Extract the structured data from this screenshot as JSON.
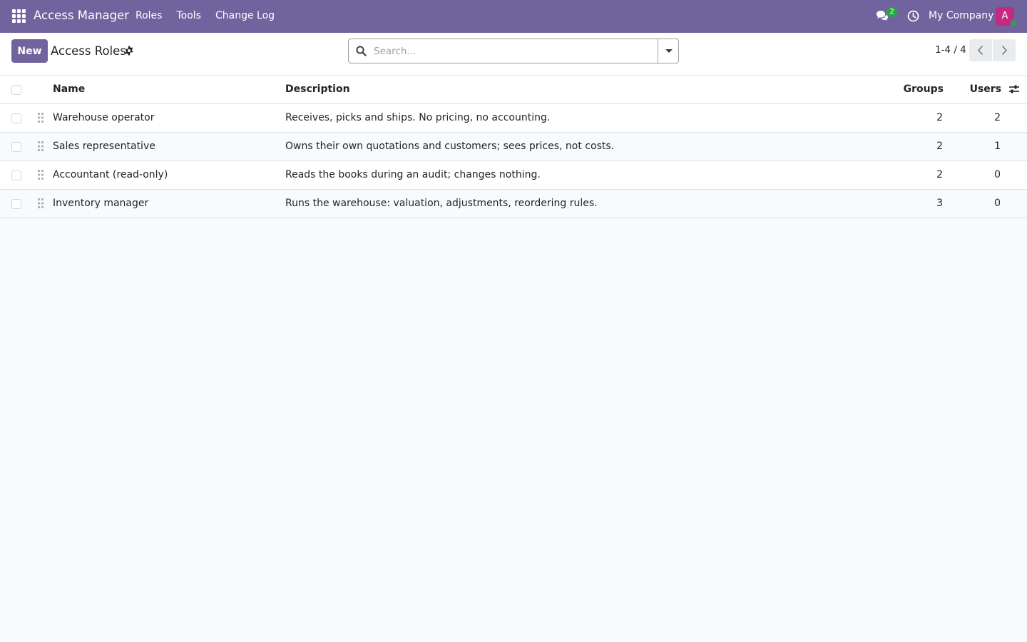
{
  "navbar": {
    "brand": "Access Manager",
    "menu": [
      "Roles",
      "Tools",
      "Change Log"
    ],
    "chat_count": "2",
    "company": "My Company",
    "avatar_letter": "A"
  },
  "control_panel": {
    "new_label": "New",
    "title": "Access Roles",
    "search_placeholder": "Search...",
    "pager": "1-4 / 4"
  },
  "list": {
    "columns": {
      "name": "Name",
      "description": "Description",
      "groups": "Groups",
      "users": "Users"
    },
    "rows": [
      {
        "name": "Warehouse operator",
        "description": "Receives, picks and ships. No pricing, no accounting.",
        "groups": "2",
        "users": "2"
      },
      {
        "name": "Sales representative",
        "description": "Owns their own quotations and customers; sees prices, not costs.",
        "groups": "2",
        "users": "1"
      },
      {
        "name": "Accountant (read-only)",
        "description": "Reads the books during an audit; changes nothing.",
        "groups": "2",
        "users": "0"
      },
      {
        "name": "Inventory manager",
        "description": "Runs the warehouse: valuation, adjustments, reordering rules.",
        "groups": "3",
        "users": "0"
      }
    ]
  },
  "colors": {
    "navbar": "#71639e",
    "primary_button": "#71639e",
    "badge": "#28a745",
    "avatar": "#c42b80"
  },
  "icons": [
    "apps-grid-icon",
    "chat-icon",
    "clock-icon",
    "gear-icon",
    "search-icon",
    "caret-down-icon",
    "chevron-left-icon",
    "chevron-right-icon",
    "drag-handle-icon",
    "optional-columns-icon"
  ]
}
